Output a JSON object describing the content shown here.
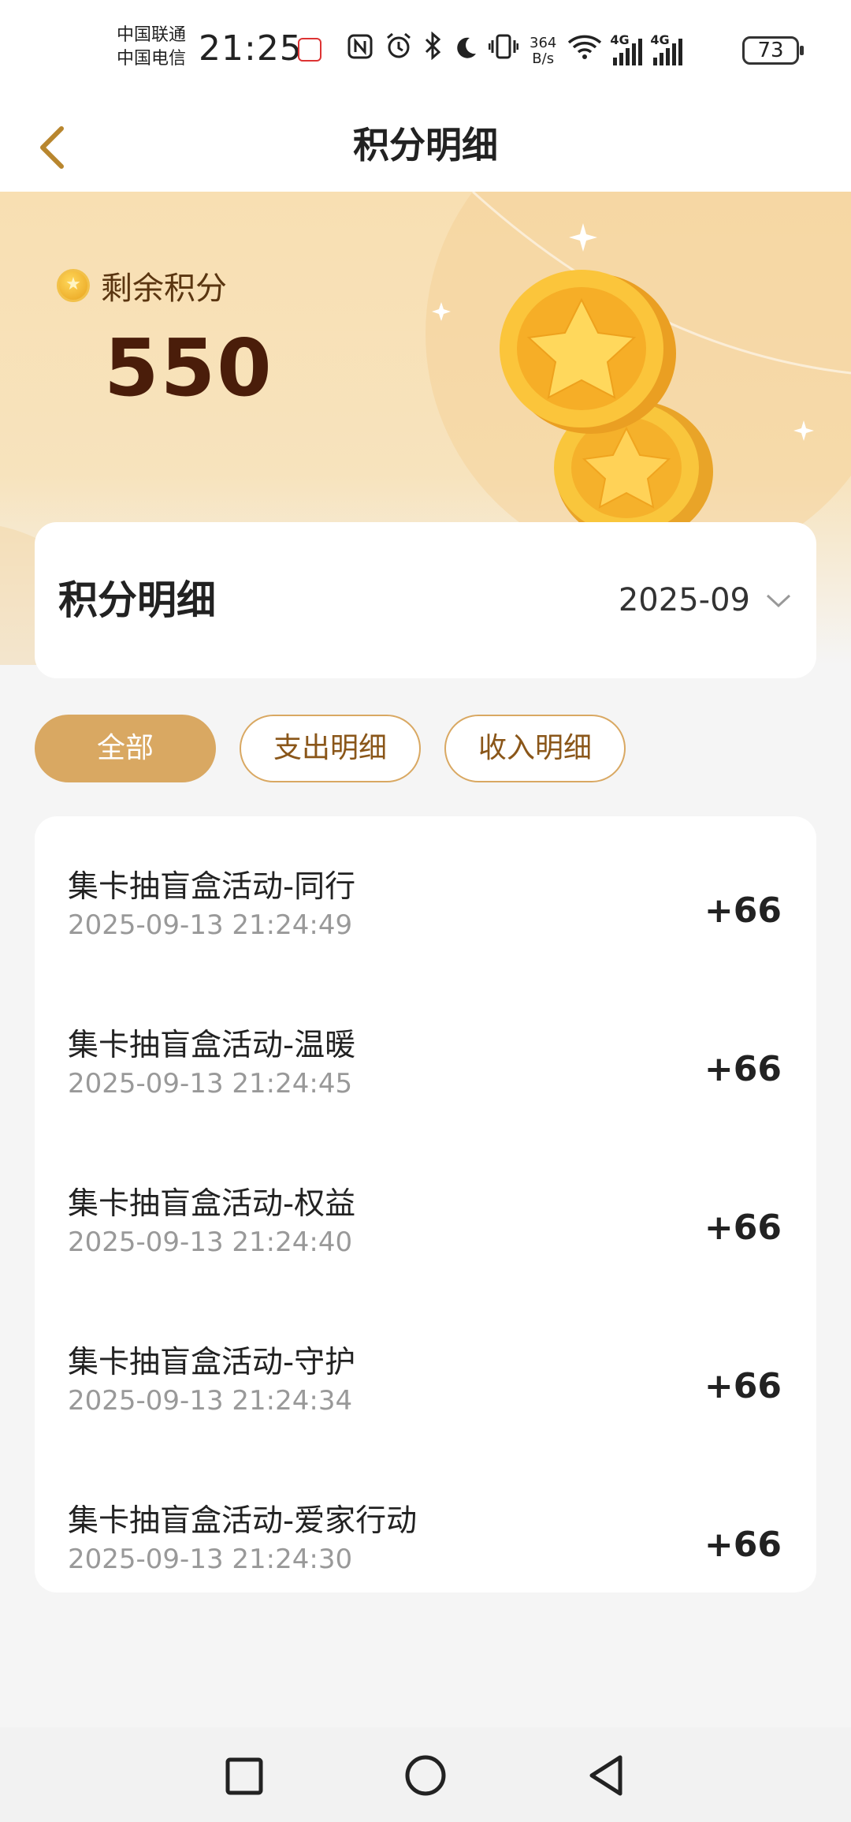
{
  "status_bar": {
    "carrier_1": "中国联通",
    "carrier_2": "中国电信",
    "time": "21:25",
    "net_speed_value": "364",
    "net_speed_unit": "B/s",
    "sig_1_tag": "4G",
    "sig_2_tag": "4G",
    "battery": "73"
  },
  "nav": {
    "title": "积分明细"
  },
  "hero": {
    "label": "剩余积分",
    "points": "550"
  },
  "summary": {
    "title": "积分明细",
    "month": "2025-09"
  },
  "tabs": [
    {
      "label": "全部",
      "active": true
    },
    {
      "label": "支出明细",
      "active": false
    },
    {
      "label": "收入明细",
      "active": false
    }
  ],
  "records": [
    {
      "title": "集卡抽盲盒活动-同行",
      "time": "2025-09-13 21:24:49",
      "amount": "+66"
    },
    {
      "title": "集卡抽盲盒活动-温暖",
      "time": "2025-09-13 21:24:45",
      "amount": "+66"
    },
    {
      "title": "集卡抽盲盒活动-权益",
      "time": "2025-09-13 21:24:40",
      "amount": "+66"
    },
    {
      "title": "集卡抽盲盒活动-守护",
      "time": "2025-09-13 21:24:34",
      "amount": "+66"
    },
    {
      "title": "集卡抽盲盒活动-爱家行动",
      "time": "2025-09-13 21:24:30",
      "amount": "+66"
    }
  ],
  "colors": {
    "accent": "#d9a862",
    "accent_text": "#8a5619",
    "points_color": "#4a1d0a",
    "back_arrow": "#b8862e"
  }
}
